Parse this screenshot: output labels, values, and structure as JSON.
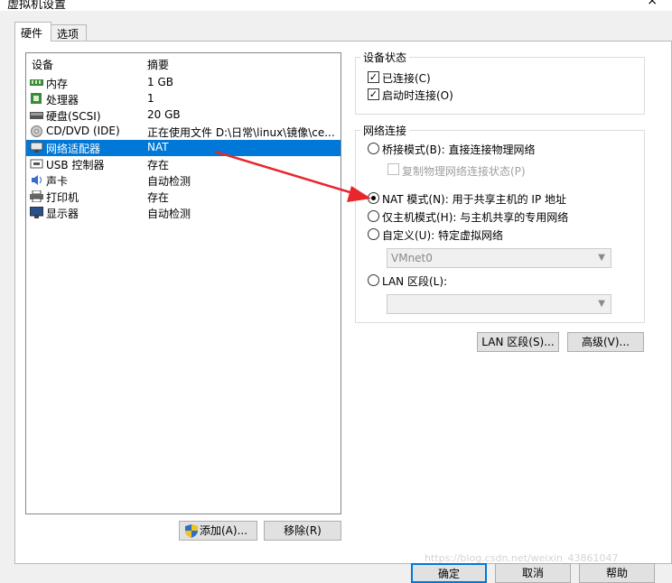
{
  "window": {
    "title": "虚拟机设置",
    "close_glyph": "×"
  },
  "tabs": [
    {
      "label": "硬件"
    },
    {
      "label": "选项"
    }
  ],
  "device_list": {
    "col_device": "设备",
    "col_summary": "摘要",
    "rows": [
      {
        "name": "内存",
        "summary": "1 GB",
        "icon": "memory-icon"
      },
      {
        "name": "处理器",
        "summary": "1",
        "icon": "processor-icon"
      },
      {
        "name": "硬盘(SCSI)",
        "summary": "20 GB",
        "icon": "hard-disk-icon"
      },
      {
        "name": "CD/DVD (IDE)",
        "summary": "正在使用文件 D:\\日常\\linux\\镜像\\ce...",
        "icon": "cd-dvd-icon"
      },
      {
        "name": "网络适配器",
        "summary": "NAT",
        "icon": "network-adapter-icon",
        "selected": true
      },
      {
        "name": "USB 控制器",
        "summary": "存在",
        "icon": "usb-icon"
      },
      {
        "name": "声卡",
        "summary": "自动检测",
        "icon": "sound-card-icon"
      },
      {
        "name": "打印机",
        "summary": "存在",
        "icon": "printer-icon"
      },
      {
        "name": "显示器",
        "summary": "自动检测",
        "icon": "display-icon"
      }
    ]
  },
  "buttons": {
    "add": "添加(A)...",
    "remove": "移除(R)",
    "lan_segments": "LAN 区段(S)...",
    "advanced": "高级(V)...",
    "ok": "确定",
    "cancel": "取消",
    "help": "帮助"
  },
  "device_status": {
    "label": "设备状态",
    "connected": "已连接(C)",
    "connect_at_power_on": "启动时连接(O)"
  },
  "network_connection": {
    "label": "网络连接",
    "bridged": "桥接模式(B): 直接连接物理网络",
    "replicate": "复制物理网络连接状态(P)",
    "nat": "NAT 模式(N): 用于共享主机的 IP 地址",
    "host_only": "仅主机模式(H): 与主机共享的专用网络",
    "custom": "自定义(U): 特定虚拟网络",
    "custom_value": "VMnet0",
    "lan_segment": "LAN 区段(L):",
    "lan_segment_value": ""
  },
  "colors": {
    "selection": "#0078d7",
    "arrow": "#e8262d"
  },
  "watermark": "https://blog.csdn.net/weixin_43861047"
}
